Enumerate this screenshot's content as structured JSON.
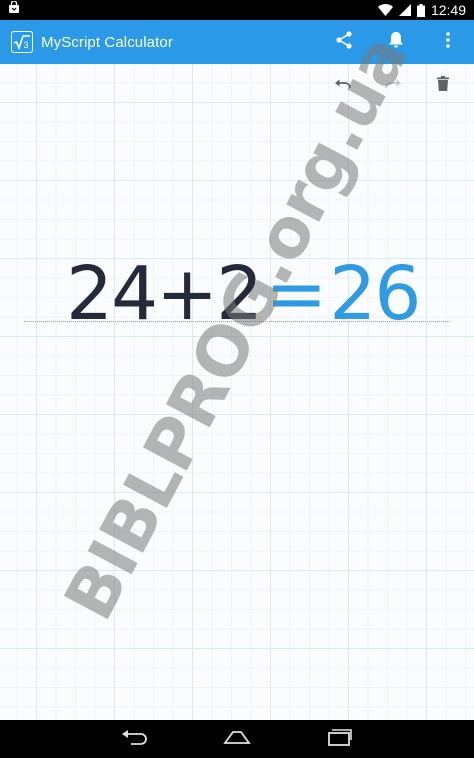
{
  "status_bar": {
    "time": "12:49",
    "icons": [
      "bag-icon",
      "wifi-icon",
      "signal-icon",
      "battery-icon"
    ]
  },
  "app_bar": {
    "logo_text": "√3",
    "title": "MyScript Calculator",
    "actions": [
      "share-icon",
      "bell-icon",
      "overflow-menu-icon"
    ]
  },
  "toolbar": {
    "icons": [
      "undo-icon",
      "redo-icon",
      "trash-icon"
    ]
  },
  "equation": {
    "expression": "24+2",
    "equals": "=",
    "result": "26"
  },
  "watermark": {
    "text": "BIBLPROG.org.ua"
  },
  "nav_bar": {
    "icons": [
      "back-icon",
      "home-icon",
      "recents-icon"
    ]
  },
  "colors": {
    "accent": "#2a9ae8",
    "expression": "#252a3a",
    "result": "#2f9be3"
  }
}
